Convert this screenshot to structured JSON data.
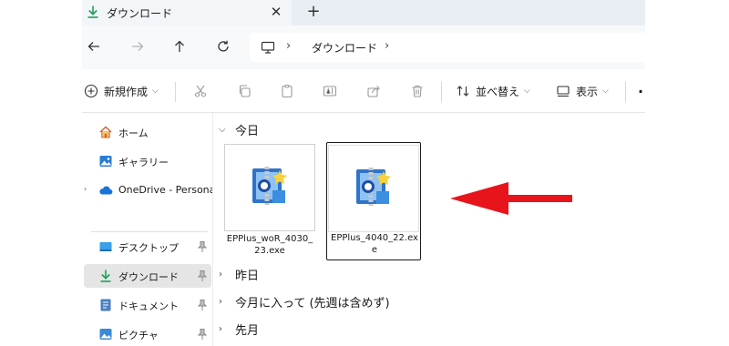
{
  "tab": {
    "title": "ダウンロード",
    "close_glyph": "✕",
    "new_tab_glyph": "+"
  },
  "address": {
    "separator": "›",
    "crumb": "ダウンロード"
  },
  "commands": {
    "new_label": "新規作成",
    "sort_label": "並べ替え",
    "view_label": "表示",
    "more_glyph": "·"
  },
  "nav": {
    "home": "ホーム",
    "gallery": "ギャラリー",
    "onedrive": "OneDrive - Persona",
    "desktop": "デスクトップ",
    "downloads": "ダウンロード",
    "documents": "ドキュメント",
    "pictures": "ピクチャ"
  },
  "groups": {
    "today": "今日",
    "yesterday": "昨日",
    "this_month": "今月に入って (先週は含めず)",
    "last_month": "先月"
  },
  "files": [
    {
      "name": "EPPlus_woR_4030_23.exe",
      "selected": false
    },
    {
      "name": "EPPlus_4040_22.exe",
      "selected": true
    }
  ],
  "colors": {
    "accent": "#0067c0",
    "annotation_arrow": "#e8141c",
    "download_green": "#1f9e5a"
  }
}
